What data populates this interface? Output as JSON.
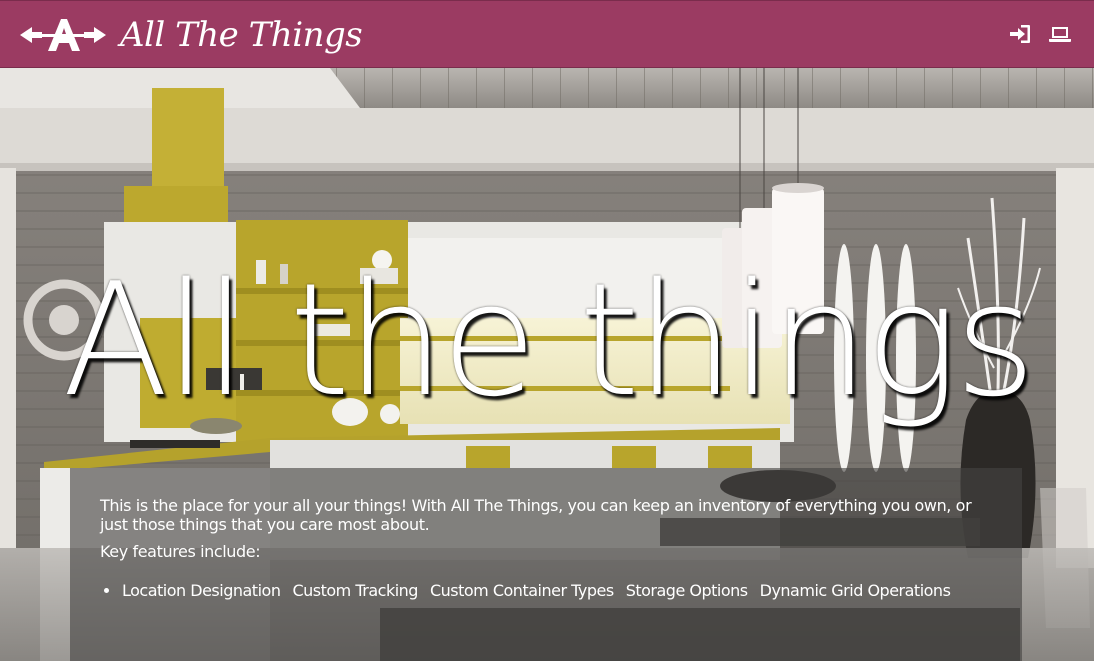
{
  "header": {
    "brand_name": "All The Things",
    "logo_icon": "arrows-a-logo-icon",
    "icons": [
      "sign-in-icon",
      "laptop-icon"
    ],
    "bar_color": "#9b3b62"
  },
  "hero": {
    "title": "All the things",
    "background": "kitchen-photo"
  },
  "info": {
    "intro": "This is the place for your all your things! With All The Things, you can keep an inventory of everything you own, or just those things that you care most about.",
    "features_label": "Key features include:",
    "features": [
      "Location Designation",
      "Custom Tracking",
      "Custom Container Types",
      "Storage Options",
      "Dynamic Grid Operations"
    ]
  }
}
